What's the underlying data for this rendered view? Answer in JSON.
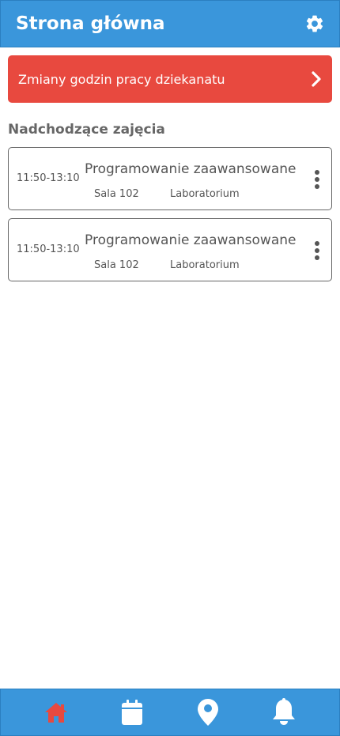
{
  "header": {
    "title": "Strona główna",
    "icon": "gear-icon"
  },
  "banner": {
    "text": "Zmiany godzin pracy dziekanatu",
    "color": "#e8493f",
    "icon": "chevron-right-icon"
  },
  "upcoming": {
    "section_title": "Nadchodzące zajęcia",
    "items": [
      {
        "time": "11:50-13:10",
        "title": "Programowanie zaawansowane",
        "room": "Sala 102",
        "type": "Laboratorium"
      },
      {
        "time": "11:50-13:10",
        "title": "Programowanie zaawansowane",
        "room": "Sala 102",
        "type": "Laboratorium"
      }
    ]
  },
  "bottom_nav": {
    "items": [
      {
        "icon": "home-icon",
        "active": true
      },
      {
        "icon": "calendar-icon",
        "active": false
      },
      {
        "icon": "map-pin-icon",
        "active": false
      },
      {
        "icon": "bell-icon",
        "active": false
      }
    ]
  },
  "colors": {
    "primary": "#3a96db",
    "alert": "#e8493f",
    "active_nav": "#e8493f",
    "text_muted": "#555555"
  }
}
